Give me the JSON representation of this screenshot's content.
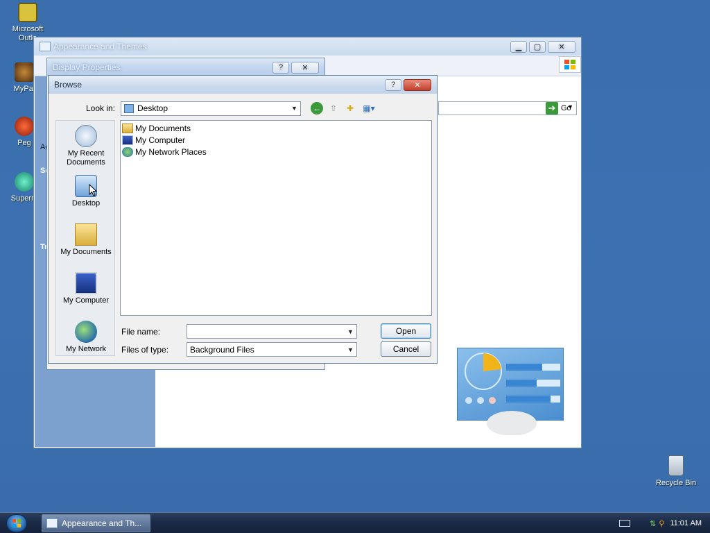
{
  "desktop": {
    "icons": [
      {
        "label_line1": "Microsoft",
        "label_line2": "Outlo"
      },
      {
        "label_line1": "MyPal"
      },
      {
        "label_line1": "Peg"
      },
      {
        "label_line1": "Superm"
      }
    ],
    "recycle_bin": "Recycle Bin"
  },
  "appearance_window": {
    "title": "Appearance and Themes",
    "go_label": "Go",
    "left_fragments": [
      "Se",
      "Ac",
      "Tr"
    ]
  },
  "display_properties": {
    "title": "Display Properties"
  },
  "browse": {
    "title": "Browse",
    "look_in_label": "Look in:",
    "look_in_value": "Desktop",
    "places": [
      {
        "label": "My Recent Documents"
      },
      {
        "label": "Desktop"
      },
      {
        "label": "My Documents"
      },
      {
        "label": "My Computer"
      },
      {
        "label": "My Network"
      }
    ],
    "files": [
      {
        "name": "My Documents",
        "icon": "folder-icon"
      },
      {
        "name": "My Computer",
        "icon": "computer-icon"
      },
      {
        "name": "My Network Places",
        "icon": "network-icon"
      }
    ],
    "file_name_label": "File name:",
    "file_name_value": "",
    "files_of_type_label": "Files of type:",
    "files_of_type_value": "Background Files",
    "open_label": "Open",
    "cancel_label": "Cancel"
  },
  "taskbar": {
    "task_label": "Appearance and Th...",
    "clock": "11:01 AM"
  },
  "colors": {
    "desktop": "#3b6fae",
    "taskbar": "#1a2a45",
    "accent": "#2f6db5"
  }
}
